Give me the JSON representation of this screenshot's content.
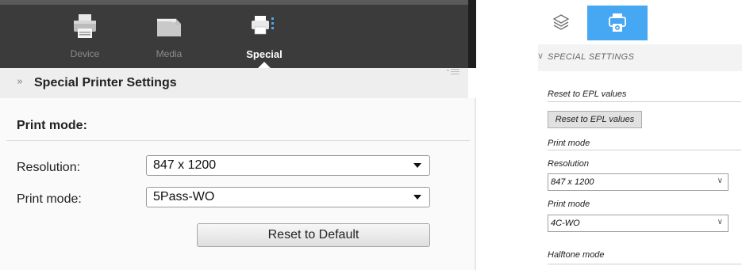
{
  "left_panel": {
    "tabs": [
      {
        "label": "Device",
        "icon": "printer-icon",
        "active": false
      },
      {
        "label": "Media",
        "icon": "media-icon",
        "active": false
      },
      {
        "label": "Special",
        "icon": "special-printer-icon",
        "active": true
      }
    ],
    "section_title": "Special Printer Settings",
    "print_mode_heading": "Print mode:",
    "resolution": {
      "label": "Resolution:",
      "value": "847 x 1200"
    },
    "print_mode": {
      "label": "Print mode:",
      "value": "5Pass-WO"
    },
    "reset_button": "Reset to Default"
  },
  "right_panel": {
    "tabs": [
      {
        "icon": "layers-icon",
        "active": false
      },
      {
        "icon": "printer-settings-icon",
        "active": true
      }
    ],
    "section_title": "SPECIAL SETTINGS",
    "reset_epl_heading": "Reset to EPL values",
    "reset_epl_button": "Reset to EPL values",
    "print_mode_heading": "Print mode",
    "resolution": {
      "label": "Resolution",
      "value": "847 x 1200"
    },
    "print_mode": {
      "label": "Print mode",
      "value": "4C-WO"
    },
    "halftone_label": "Halftone mode",
    "accent_color": "#46a7f2"
  }
}
